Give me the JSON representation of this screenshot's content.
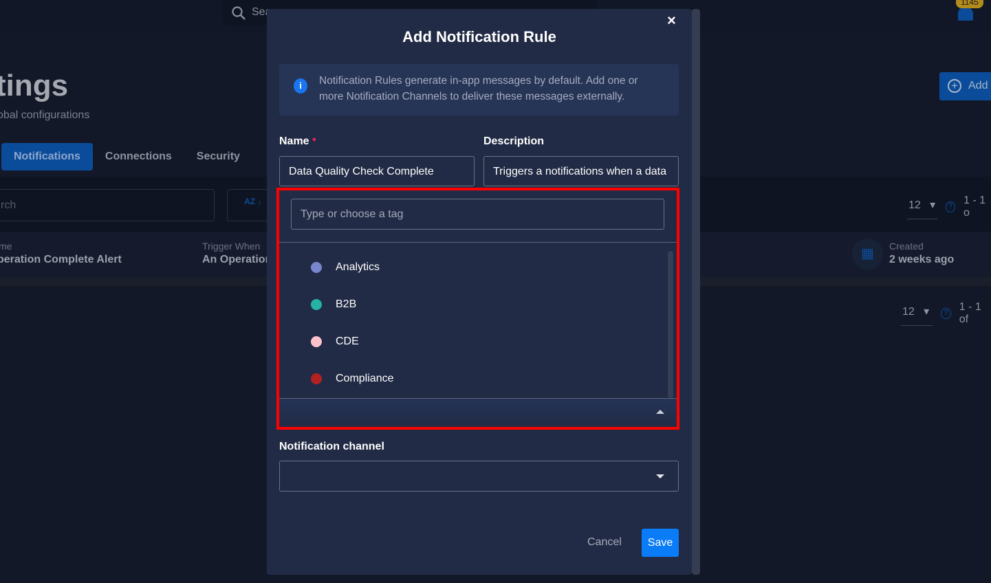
{
  "background": {
    "search_placeholder": "Sea",
    "notification_count": "1145",
    "page_title": "tings",
    "page_subtitle": "obal configurations",
    "add_button": "Add",
    "tabs": [
      {
        "label": "Notifications",
        "active": true
      },
      {
        "label": "Connections"
      },
      {
        "label": "Security"
      }
    ],
    "list_search_placeholder": "rch",
    "sort_icon_label": "AZ",
    "pager_top": {
      "per_page": "12",
      "range": "1 - 1 o"
    },
    "pager_bottom": {
      "per_page": "12",
      "range": "1 - 1 of"
    },
    "row": {
      "name_label": "me",
      "name_value": "peration Complete Alert",
      "trigger_label": "Trigger When",
      "trigger_value": "An Operation",
      "created_label": "Created",
      "created_value": "2 weeks ago"
    }
  },
  "modal": {
    "title": "Add Notification Rule",
    "close_label": "×",
    "info_text": "Notification Rules generate in-app messages by default. Add one or more Notification Channels to deliver these messages externally.",
    "name_label": "Name",
    "name_value": "Data Quality Check Complete",
    "description_label": "Description",
    "description_value": "Triggers a notifications when a data",
    "tag_placeholder": "Type or choose a tag",
    "tag_options": [
      {
        "label": "Analytics",
        "color": "#7986cb"
      },
      {
        "label": "B2B",
        "color": "#26b3a6"
      },
      {
        "label": "CDE",
        "color": "#ffc1cc"
      },
      {
        "label": "Compliance",
        "color": "#b22222"
      }
    ],
    "channel_label": "Notification channel",
    "channel_value": "",
    "cancel_label": "Cancel",
    "save_label": "Save"
  }
}
